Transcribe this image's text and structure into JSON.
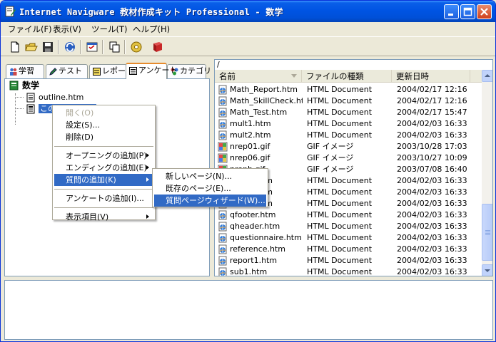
{
  "window": {
    "title": "Internet Navigware 教材作成キット Professional - 数学"
  },
  "menubar": {
    "items": [
      "ファイル(F)",
      "表示(V)",
      "ツール(T)",
      "ヘルプ(H)"
    ]
  },
  "toolbar": {
    "buttons": [
      "new-file-icon",
      "open-folder-icon",
      "save-icon",
      "refresh-icon",
      "checklist-icon",
      "copy-pages-icon",
      "settings-cd-icon",
      "book-icon"
    ]
  },
  "tabs": [
    {
      "label": "学習",
      "icon": "people-icon"
    },
    {
      "label": "テスト",
      "icon": "pencil-icon"
    },
    {
      "label": "レポート",
      "icon": "report-icon"
    },
    {
      "label": "アンケート",
      "icon": "survey-icon",
      "active": true
    },
    {
      "label": "カテゴリ",
      "icon": "category-icon"
    }
  ],
  "tree": {
    "root": "数学",
    "children": [
      {
        "label": "outline.htm"
      },
      {
        "label": "このアンケート",
        "selected": true
      }
    ]
  },
  "filelist": {
    "path": "/",
    "columns": [
      "名前",
      "ファイルの種類",
      "更新日時"
    ],
    "rows": [
      {
        "name": "Math_Report.htm",
        "type": "HTML Document",
        "date": "2004/02/17 12:16",
        "icon": "html"
      },
      {
        "name": "Math_SkillCheck.htm",
        "type": "HTML Document",
        "date": "2004/02/17 12:16",
        "icon": "html"
      },
      {
        "name": "Math_Test.htm",
        "type": "HTML Document",
        "date": "2004/02/17 15:47",
        "icon": "html"
      },
      {
        "name": "mult1.htm",
        "type": "HTML Document",
        "date": "2004/02/03 16:33",
        "icon": "html"
      },
      {
        "name": "mult2.htm",
        "type": "HTML Document",
        "date": "2004/02/03 16:33",
        "icon": "html"
      },
      {
        "name": "nrep01.gif",
        "type": "GIF イメージ",
        "date": "2003/10/28 17:03",
        "icon": "gif"
      },
      {
        "name": "nrep06.gif",
        "type": "GIF イメージ",
        "date": "2003/10/27 10:09",
        "icon": "gif"
      },
      {
        "name": "nrepb.gif",
        "type": "GIF イメージ",
        "date": "2003/07/08 16:40",
        "icon": "gif"
      },
      {
        "name": "page1.htm",
        "type": "HTML Document",
        "date": "2004/02/03 16:33",
        "icon": "html"
      },
      {
        "name": "page2.htm",
        "type": "HTML Document",
        "date": "2004/02/03 16:33",
        "icon": "html"
      },
      {
        "name": "page3.htm",
        "type": "HTML Document",
        "date": "2004/02/03 16:33",
        "icon": "html"
      },
      {
        "name": "qfooter.htm",
        "type": "HTML Document",
        "date": "2004/02/03 16:33",
        "icon": "html"
      },
      {
        "name": "qheader.htm",
        "type": "HTML Document",
        "date": "2004/02/03 16:33",
        "icon": "html"
      },
      {
        "name": "questionnaire.htm",
        "type": "HTML Document",
        "date": "2004/02/03 16:33",
        "icon": "html"
      },
      {
        "name": "reference.htm",
        "type": "HTML Document",
        "date": "2004/02/03 16:33",
        "icon": "html"
      },
      {
        "name": "report1.htm",
        "type": "HTML Document",
        "date": "2004/02/03 16:33",
        "icon": "html"
      },
      {
        "name": "sub1.htm",
        "type": "HTML Document",
        "date": "2004/02/03 16:33",
        "icon": "html"
      }
    ]
  },
  "context_menu": {
    "items": [
      {
        "label": "開く(O)",
        "disabled": true
      },
      {
        "label": "設定(S)..."
      },
      {
        "label": "削除(D)"
      },
      {
        "separator": true
      },
      {
        "label": "オープニングの追加(P)",
        "submenu": true
      },
      {
        "label": "エンディングの追加(E)",
        "submenu": true
      },
      {
        "label": "質問の追加(K)",
        "submenu": true,
        "highlight": true
      },
      {
        "separator": true
      },
      {
        "label": "アンケートの追加(I)..."
      },
      {
        "separator": true
      },
      {
        "label": "表示項目(V)",
        "submenu": true
      }
    ]
  },
  "submenu": {
    "items": [
      {
        "label": "新しいページ(N)..."
      },
      {
        "label": "既存のページ(E)..."
      },
      {
        "label": "質問ページウィザード(W)...",
        "highlight": true
      }
    ]
  },
  "colors": {
    "titlebar": "#0054e3",
    "selection": "#316ac5",
    "tab_accent": "#e68b2c"
  }
}
